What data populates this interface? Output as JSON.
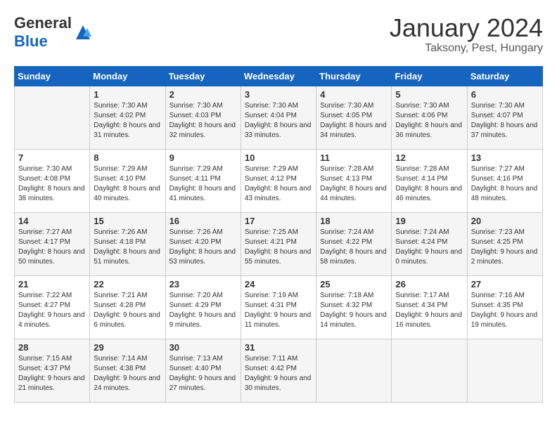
{
  "header": {
    "logo_general": "General",
    "logo_blue": "Blue",
    "month": "January 2024",
    "location": "Taksony, Pest, Hungary"
  },
  "days_of_week": [
    "Sunday",
    "Monday",
    "Tuesday",
    "Wednesday",
    "Thursday",
    "Friday",
    "Saturday"
  ],
  "weeks": [
    [
      {
        "day": "",
        "sunrise": "",
        "sunset": "",
        "daylight": ""
      },
      {
        "day": "1",
        "sunrise": "Sunrise: 7:30 AM",
        "sunset": "Sunset: 4:02 PM",
        "daylight": "Daylight: 8 hours and 31 minutes."
      },
      {
        "day": "2",
        "sunrise": "Sunrise: 7:30 AM",
        "sunset": "Sunset: 4:03 PM",
        "daylight": "Daylight: 8 hours and 32 minutes."
      },
      {
        "day": "3",
        "sunrise": "Sunrise: 7:30 AM",
        "sunset": "Sunset: 4:04 PM",
        "daylight": "Daylight: 8 hours and 33 minutes."
      },
      {
        "day": "4",
        "sunrise": "Sunrise: 7:30 AM",
        "sunset": "Sunset: 4:05 PM",
        "daylight": "Daylight: 8 hours and 34 minutes."
      },
      {
        "day": "5",
        "sunrise": "Sunrise: 7:30 AM",
        "sunset": "Sunset: 4:06 PM",
        "daylight": "Daylight: 8 hours and 36 minutes."
      },
      {
        "day": "6",
        "sunrise": "Sunrise: 7:30 AM",
        "sunset": "Sunset: 4:07 PM",
        "daylight": "Daylight: 8 hours and 37 minutes."
      }
    ],
    [
      {
        "day": "7",
        "sunrise": "Sunrise: 7:30 AM",
        "sunset": "Sunset: 4:08 PM",
        "daylight": "Daylight: 8 hours and 38 minutes."
      },
      {
        "day": "8",
        "sunrise": "Sunrise: 7:29 AM",
        "sunset": "Sunset: 4:10 PM",
        "daylight": "Daylight: 8 hours and 40 minutes."
      },
      {
        "day": "9",
        "sunrise": "Sunrise: 7:29 AM",
        "sunset": "Sunset: 4:11 PM",
        "daylight": "Daylight: 8 hours and 41 minutes."
      },
      {
        "day": "10",
        "sunrise": "Sunrise: 7:29 AM",
        "sunset": "Sunset: 4:12 PM",
        "daylight": "Daylight: 8 hours and 43 minutes."
      },
      {
        "day": "11",
        "sunrise": "Sunrise: 7:28 AM",
        "sunset": "Sunset: 4:13 PM",
        "daylight": "Daylight: 8 hours and 44 minutes."
      },
      {
        "day": "12",
        "sunrise": "Sunrise: 7:28 AM",
        "sunset": "Sunset: 4:14 PM",
        "daylight": "Daylight: 8 hours and 46 minutes."
      },
      {
        "day": "13",
        "sunrise": "Sunrise: 7:27 AM",
        "sunset": "Sunset: 4:16 PM",
        "daylight": "Daylight: 8 hours and 48 minutes."
      }
    ],
    [
      {
        "day": "14",
        "sunrise": "Sunrise: 7:27 AM",
        "sunset": "Sunset: 4:17 PM",
        "daylight": "Daylight: 8 hours and 50 minutes."
      },
      {
        "day": "15",
        "sunrise": "Sunrise: 7:26 AM",
        "sunset": "Sunset: 4:18 PM",
        "daylight": "Daylight: 8 hours and 51 minutes."
      },
      {
        "day": "16",
        "sunrise": "Sunrise: 7:26 AM",
        "sunset": "Sunset: 4:20 PM",
        "daylight": "Daylight: 8 hours and 53 minutes."
      },
      {
        "day": "17",
        "sunrise": "Sunrise: 7:25 AM",
        "sunset": "Sunset: 4:21 PM",
        "daylight": "Daylight: 8 hours and 55 minutes."
      },
      {
        "day": "18",
        "sunrise": "Sunrise: 7:24 AM",
        "sunset": "Sunset: 4:22 PM",
        "daylight": "Daylight: 8 hours and 58 minutes."
      },
      {
        "day": "19",
        "sunrise": "Sunrise: 7:24 AM",
        "sunset": "Sunset: 4:24 PM",
        "daylight": "Daylight: 9 hours and 0 minutes."
      },
      {
        "day": "20",
        "sunrise": "Sunrise: 7:23 AM",
        "sunset": "Sunset: 4:25 PM",
        "daylight": "Daylight: 9 hours and 2 minutes."
      }
    ],
    [
      {
        "day": "21",
        "sunrise": "Sunrise: 7:22 AM",
        "sunset": "Sunset: 4:27 PM",
        "daylight": "Daylight: 9 hours and 4 minutes."
      },
      {
        "day": "22",
        "sunrise": "Sunrise: 7:21 AM",
        "sunset": "Sunset: 4:28 PM",
        "daylight": "Daylight: 9 hours and 6 minutes."
      },
      {
        "day": "23",
        "sunrise": "Sunrise: 7:20 AM",
        "sunset": "Sunset: 4:29 PM",
        "daylight": "Daylight: 9 hours and 9 minutes."
      },
      {
        "day": "24",
        "sunrise": "Sunrise: 7:19 AM",
        "sunset": "Sunset: 4:31 PM",
        "daylight": "Daylight: 9 hours and 11 minutes."
      },
      {
        "day": "25",
        "sunrise": "Sunrise: 7:18 AM",
        "sunset": "Sunset: 4:32 PM",
        "daylight": "Daylight: 9 hours and 14 minutes."
      },
      {
        "day": "26",
        "sunrise": "Sunrise: 7:17 AM",
        "sunset": "Sunset: 4:34 PM",
        "daylight": "Daylight: 9 hours and 16 minutes."
      },
      {
        "day": "27",
        "sunrise": "Sunrise: 7:16 AM",
        "sunset": "Sunset: 4:35 PM",
        "daylight": "Daylight: 9 hours and 19 minutes."
      }
    ],
    [
      {
        "day": "28",
        "sunrise": "Sunrise: 7:15 AM",
        "sunset": "Sunset: 4:37 PM",
        "daylight": "Daylight: 9 hours and 21 minutes."
      },
      {
        "day": "29",
        "sunrise": "Sunrise: 7:14 AM",
        "sunset": "Sunset: 4:38 PM",
        "daylight": "Daylight: 9 hours and 24 minutes."
      },
      {
        "day": "30",
        "sunrise": "Sunrise: 7:13 AM",
        "sunset": "Sunset: 4:40 PM",
        "daylight": "Daylight: 9 hours and 27 minutes."
      },
      {
        "day": "31",
        "sunrise": "Sunrise: 7:11 AM",
        "sunset": "Sunset: 4:42 PM",
        "daylight": "Daylight: 9 hours and 30 minutes."
      },
      {
        "day": "",
        "sunrise": "",
        "sunset": "",
        "daylight": ""
      },
      {
        "day": "",
        "sunrise": "",
        "sunset": "",
        "daylight": ""
      },
      {
        "day": "",
        "sunrise": "",
        "sunset": "",
        "daylight": ""
      }
    ]
  ]
}
